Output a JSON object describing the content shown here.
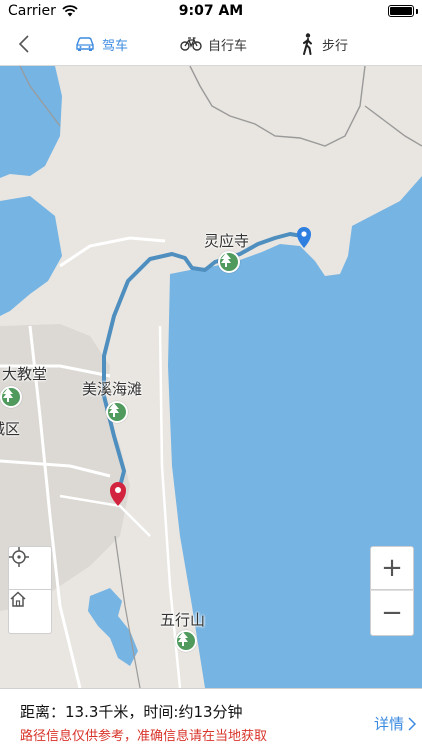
{
  "status_bar": {
    "carrier": "Carrier",
    "time": "9:07 AM",
    "battery_level": 1.0
  },
  "nav": {
    "tabs": [
      {
        "label": "驾车",
        "icon": "car-icon",
        "active": true
      },
      {
        "label": "自行车",
        "icon": "bicycle-icon",
        "active": false
      },
      {
        "label": "步行",
        "icon": "walk-icon",
        "active": false
      }
    ]
  },
  "map": {
    "labels": {
      "temple": "灵应寺",
      "beach": "美溪海滩",
      "church": "大教堂",
      "district": "城区",
      "mountain": "五行山"
    },
    "colors": {
      "water": "#76b4e3",
      "land": "#e9e6e1",
      "route": "#4f8fc0",
      "start_marker": "#d2243f",
      "end_marker": "#2f7fe0",
      "park": "#4f9a5c"
    }
  },
  "controls": {
    "zoom_in": "+",
    "zoom_out": "−"
  },
  "info": {
    "summary": "距离：13.3千米，时间:约13分钟",
    "note": "路径信息仅供参考，准确信息请在当地获取",
    "detail_label": "详情"
  }
}
